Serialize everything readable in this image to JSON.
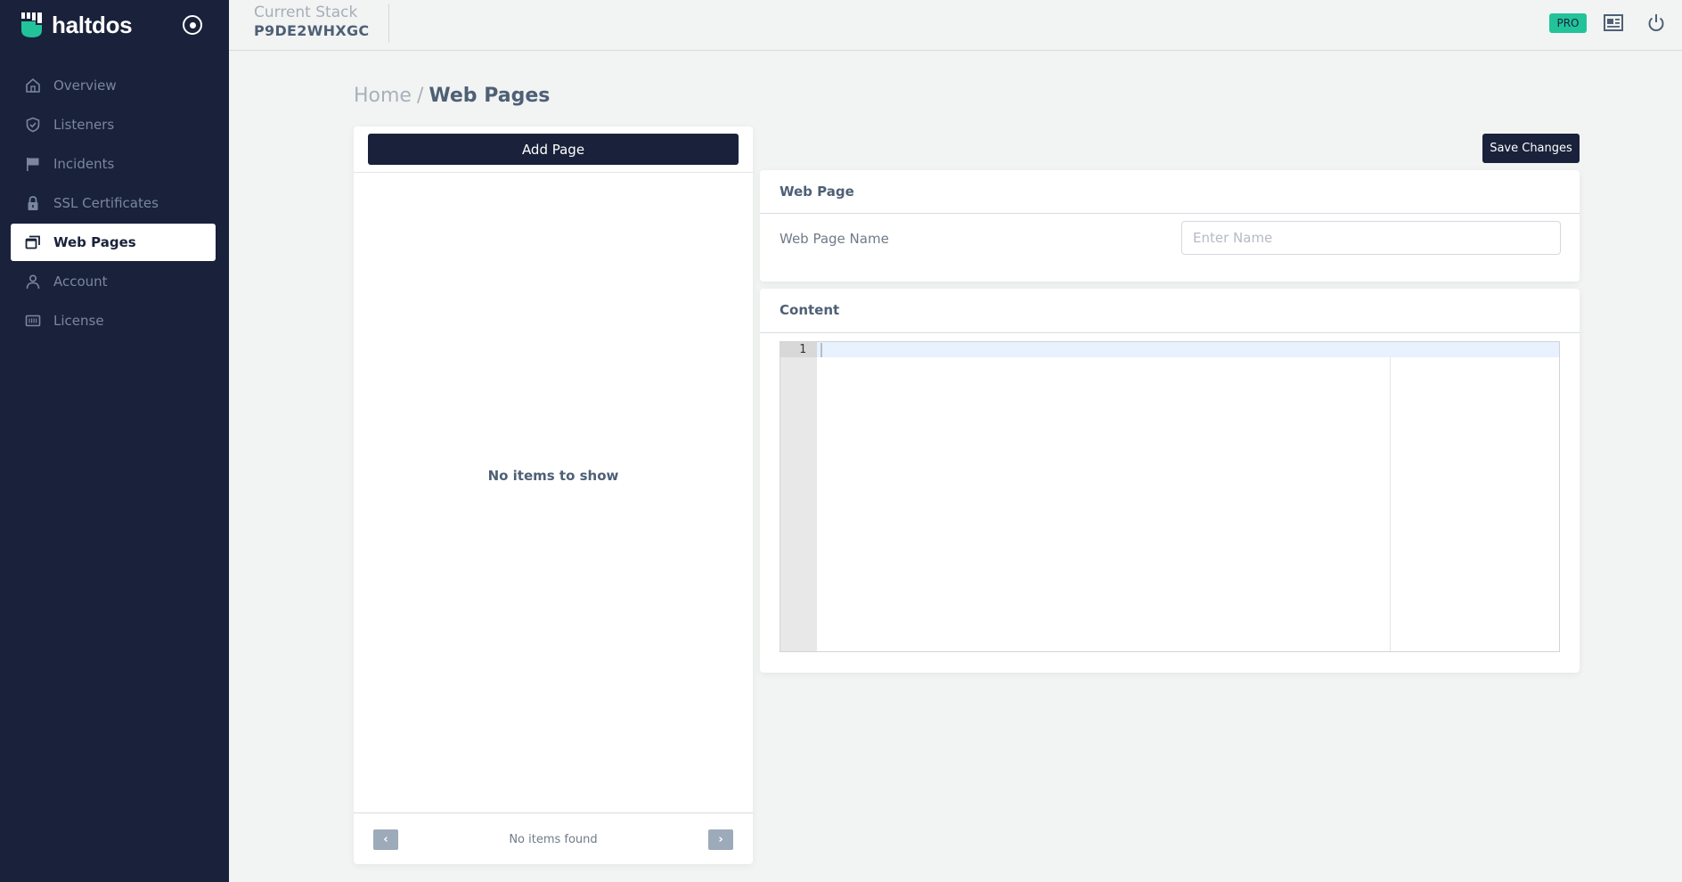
{
  "app": {
    "brand_name": "haltdos"
  },
  "sidebar": {
    "items": [
      {
        "label": "Overview",
        "icon": "home-icon",
        "active": false
      },
      {
        "label": "Listeners",
        "icon": "shield-check-icon",
        "active": false
      },
      {
        "label": "Incidents",
        "icon": "flag-icon",
        "active": false
      },
      {
        "label": "SSL Certificates",
        "icon": "lock-icon",
        "active": false
      },
      {
        "label": "Web Pages",
        "icon": "windows-icon",
        "active": true
      },
      {
        "label": "Account",
        "icon": "user-icon",
        "active": false
      },
      {
        "label": "License",
        "icon": "license-icon",
        "active": false
      }
    ]
  },
  "header": {
    "stack_label": "Current Stack",
    "stack_value": "P9DE2WHXGC",
    "badge": "PRO",
    "badge_color": "#22c39b"
  },
  "breadcrumb": {
    "home": "Home",
    "separator": "/",
    "current": "Web Pages"
  },
  "list_panel": {
    "add_button": "Add Page",
    "empty_message": "No items to show",
    "pager_prev": "‹",
    "pager_next": "›",
    "pager_status": "No items found"
  },
  "toolbar": {
    "save_label": "Save Changes"
  },
  "web_page_card": {
    "title": "Web Page",
    "name_label": "Web Page Name",
    "name_value": "",
    "name_placeholder": "Enter Name"
  },
  "content_card": {
    "title": "Content",
    "editor_lines": [
      "1"
    ]
  },
  "colors": {
    "sidebar_bg": "#19223a",
    "accent": "#22c39b",
    "page_bg": "#f2f4f3"
  }
}
